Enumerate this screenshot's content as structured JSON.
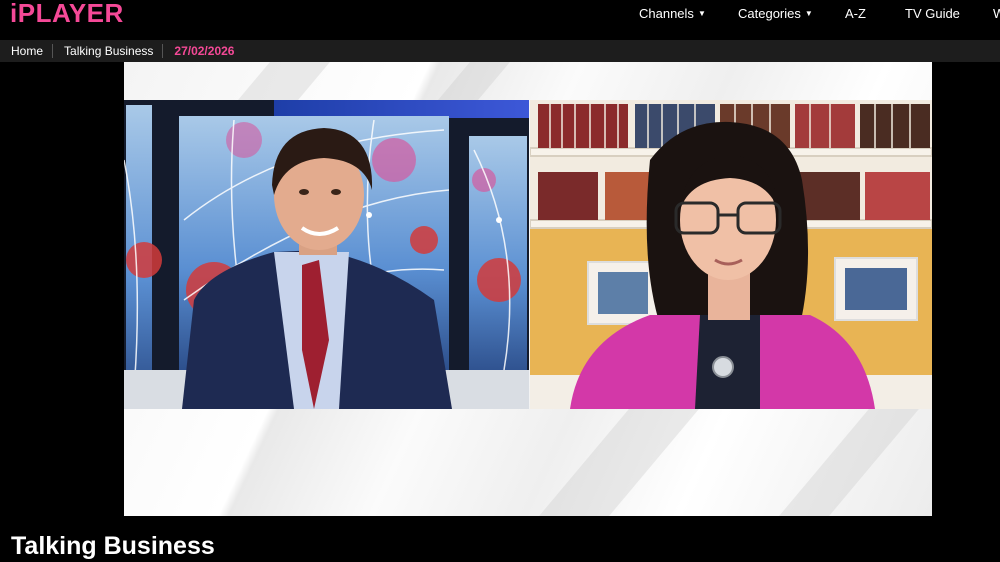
{
  "brand": {
    "logo": "iPLAYER",
    "accent": "#f54997"
  },
  "nav": {
    "items": [
      {
        "label": "Channels",
        "dropdown": true
      },
      {
        "label": "Categories",
        "dropdown": true
      },
      {
        "label": "A-Z",
        "dropdown": false
      },
      {
        "label": "TV Guide",
        "dropdown": false
      },
      {
        "label": "W",
        "dropdown": false
      }
    ]
  },
  "breadcrumb": {
    "home": "Home",
    "programme": "Talking Business",
    "date": "27/02/2026"
  },
  "video": {
    "left_speaker": "presenter in studio",
    "right_speaker": "guest via video link"
  },
  "programme": {
    "title": "Talking Business"
  }
}
